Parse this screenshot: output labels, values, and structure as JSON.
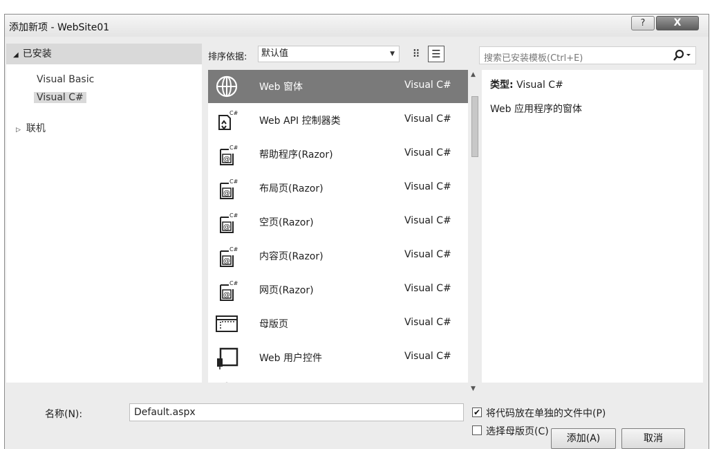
{
  "window": {
    "title": "添加新项 - WebSite01",
    "help_label": "?",
    "close_label": "X"
  },
  "left_pane": {
    "installed_label": "已安装",
    "tree_items": [
      {
        "label": "Visual Basic",
        "selected": false
      },
      {
        "label": "Visual C#",
        "selected": true
      }
    ],
    "online_label": "联机"
  },
  "sort": {
    "label": "排序依据:",
    "value": "默认值"
  },
  "search": {
    "placeholder": "搜索已安装模板(Ctrl+E)"
  },
  "templates": [
    {
      "name": "Web 窗体",
      "lang": "Visual C#",
      "icon": "globe-icon",
      "selected": true
    },
    {
      "name": "Web API 控制器类",
      "lang": "Visual C#",
      "icon": "web-api-controller-icon",
      "selected": false
    },
    {
      "name": "帮助程序(Razor)",
      "lang": "Visual C#",
      "icon": "razor-page-icon",
      "selected": false
    },
    {
      "name": "布局页(Razor)",
      "lang": "Visual C#",
      "icon": "razor-page-icon",
      "selected": false
    },
    {
      "name": "空页(Razor)",
      "lang": "Visual C#",
      "icon": "razor-page-icon",
      "selected": false
    },
    {
      "name": "内容页(Razor)",
      "lang": "Visual C#",
      "icon": "razor-page-icon",
      "selected": false
    },
    {
      "name": "网页(Razor)",
      "lang": "Visual C#",
      "icon": "razor-page-icon",
      "selected": false
    },
    {
      "name": "母版页",
      "lang": "Visual C#",
      "icon": "master-page-icon",
      "selected": false
    },
    {
      "name": "Web 用户控件",
      "lang": "Visual C#",
      "icon": "user-control-icon",
      "selected": false
    }
  ],
  "details": {
    "type_label": "类型:",
    "type_value": "Visual C#",
    "description": "Web 应用程序的窗体"
  },
  "form": {
    "name_label": "名称(N):",
    "name_value": "Default.aspx",
    "separate_code_label": "将代码放在单独的文件中(P)",
    "separate_code_checked": true,
    "master_page_label": "选择母版页(C)",
    "master_page_checked": false,
    "add_label": "添加(A)",
    "cancel_label": "取消"
  }
}
